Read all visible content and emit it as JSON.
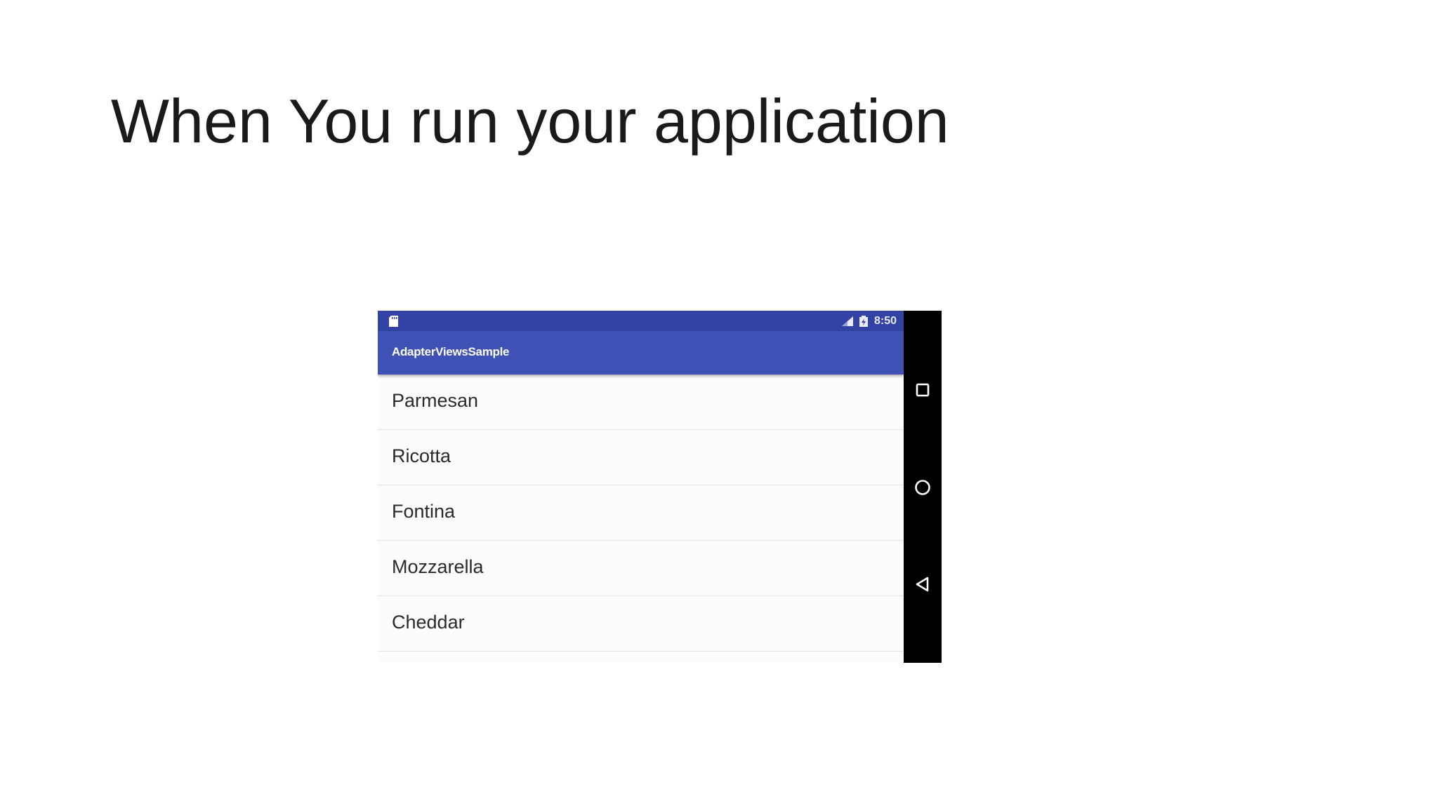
{
  "slide": {
    "title": "When You run your application"
  },
  "device": {
    "status_bar": {
      "time": "8:50",
      "left_icon": "sd-card-icon",
      "right_icons": [
        "signal-icon",
        "battery-icon"
      ],
      "color": "#3243a5"
    },
    "app_bar": {
      "title": "AdapterViewsSample",
      "color": "#3f51b5"
    },
    "list": {
      "items": [
        {
          "label": "Parmesan"
        },
        {
          "label": "Ricotta"
        },
        {
          "label": "Fontina"
        },
        {
          "label": "Mozzarella"
        },
        {
          "label": "Cheddar"
        }
      ]
    },
    "nav_bar": {
      "buttons": [
        "recents-icon",
        "home-icon",
        "back-icon"
      ]
    }
  }
}
